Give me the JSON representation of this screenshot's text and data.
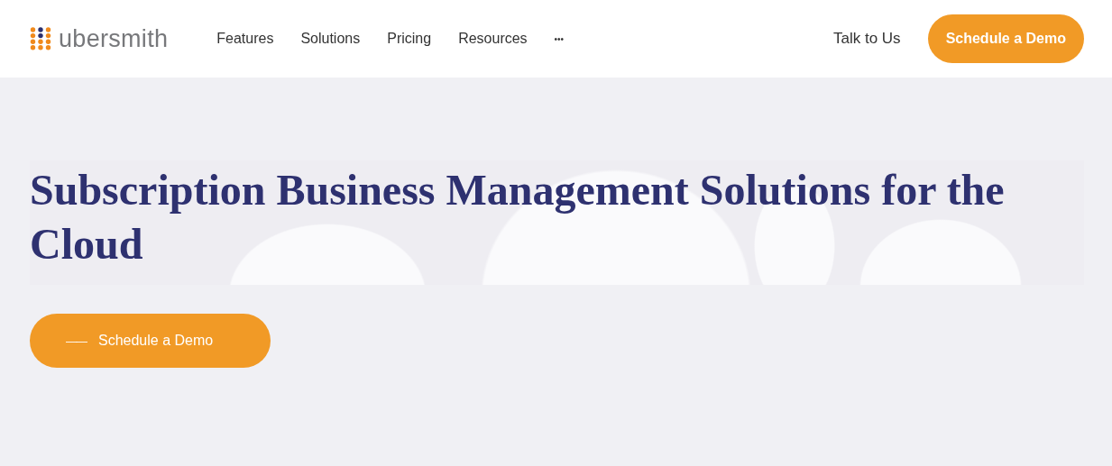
{
  "header": {
    "logo": {
      "text": "ubersmith"
    },
    "nav": [
      {
        "label": "Features"
      },
      {
        "label": "Solutions"
      },
      {
        "label": "Pricing"
      },
      {
        "label": "Resources"
      },
      {
        "label": "•••"
      }
    ],
    "talk_link": "Talk to Us",
    "demo_button": "Schedule a Demo"
  },
  "hero": {
    "title": "Subscription Business Management Solutions for the Cloud",
    "cta_dash": "——",
    "cta_label": "Schedule a Demo"
  }
}
